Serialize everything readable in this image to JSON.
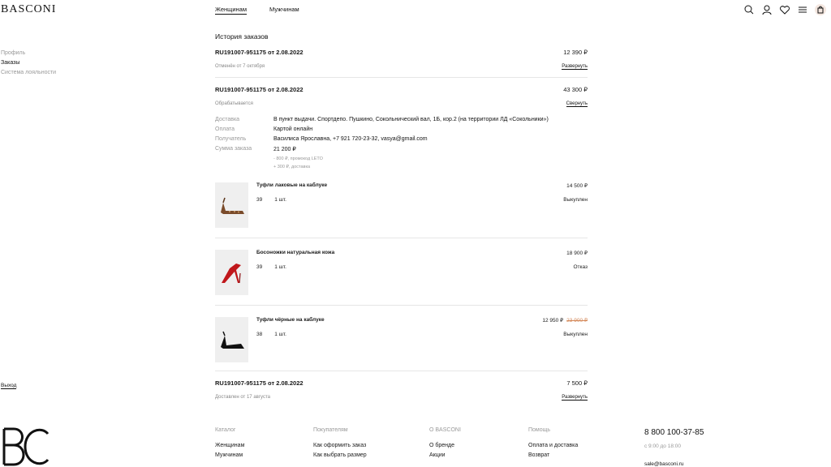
{
  "header": {
    "logo": "BASCONI",
    "nav": [
      "Женщинам",
      "Мужчинам"
    ]
  },
  "sidebar": {
    "items": [
      "Профиль",
      "Заказы",
      "Система лояльности"
    ],
    "logout": "Выход"
  },
  "page_title": "История заказов",
  "orders": [
    {
      "number": "RU191007-951175 от 2.08.2022",
      "total": "12 390 ₽",
      "status": "Отменён от 7 октября",
      "toggle": "Развернуть"
    },
    {
      "number": "RU191007-951175 от 2.08.2022",
      "total": "43 300 ₽",
      "status": "Обрабатывается",
      "toggle": "Свернуть",
      "details": {
        "delivery_label": "Доставка",
        "delivery": "В пункт выдачи. Спортдепо. Пушкино, Сокольнический вал, 1Б, кор.2 (на территории ЛД «Сокольники»)",
        "payment_label": "Оплата",
        "payment": "Картой онлайн",
        "recipient_label": "Получатель",
        "recipient": "Василиса Ярославна, +7 921 720-23-32, vasya@gmail.com",
        "sum_label": "Сумма заказа",
        "sum": "21 200 ₽",
        "note1": "- 800 ₽, промокод LETO",
        "note2": "+ 300 ₽, доставка"
      },
      "items": [
        {
          "name": "Туфли лаковые на каблуке",
          "size": "39",
          "qty": "1 шт.",
          "price": "14 500 ₽",
          "state": "Выкуплен",
          "old_price": ""
        },
        {
          "name": "Босоножки натуральная кожа",
          "size": "39",
          "qty": "1 шт.",
          "price": "18 900 ₽",
          "state": "Отказ",
          "old_price": ""
        },
        {
          "name": "Туфли чёрные на каблуке",
          "size": "38",
          "qty": "1 шт.",
          "price": "12 950 ₽",
          "state": "Выкуплен",
          "old_price": "23 900 ₽"
        }
      ]
    },
    {
      "number": "RU191007-951175 от 2.08.2022",
      "total": "7 500 ₽",
      "status": "Доставлен от 17 августа",
      "toggle": "Развернуть"
    }
  ],
  "footer": {
    "col1": {
      "title": "Каталог",
      "links": [
        "Женщинам",
        "Мужчинам"
      ]
    },
    "col2": {
      "title": "Покупателям",
      "links": [
        "Как оформить заказ",
        "Как выбрать размер"
      ]
    },
    "col3": {
      "title": "О BASCONI",
      "links": [
        "О бренде",
        "Акции"
      ]
    },
    "col4": {
      "title": "Помощь",
      "links": [
        "Оплата и доставка",
        "Возврат"
      ]
    },
    "phone": "8 800 100-37-85",
    "hours": "с 9:00 до 18:00",
    "email": "sale@basconi.ru"
  },
  "colors": {
    "accent": "#d4895a",
    "muted": "#999999",
    "text": "#111111"
  },
  "icons": [
    "search-icon",
    "user-icon",
    "heart-icon",
    "menu-icon",
    "bag-icon"
  ]
}
